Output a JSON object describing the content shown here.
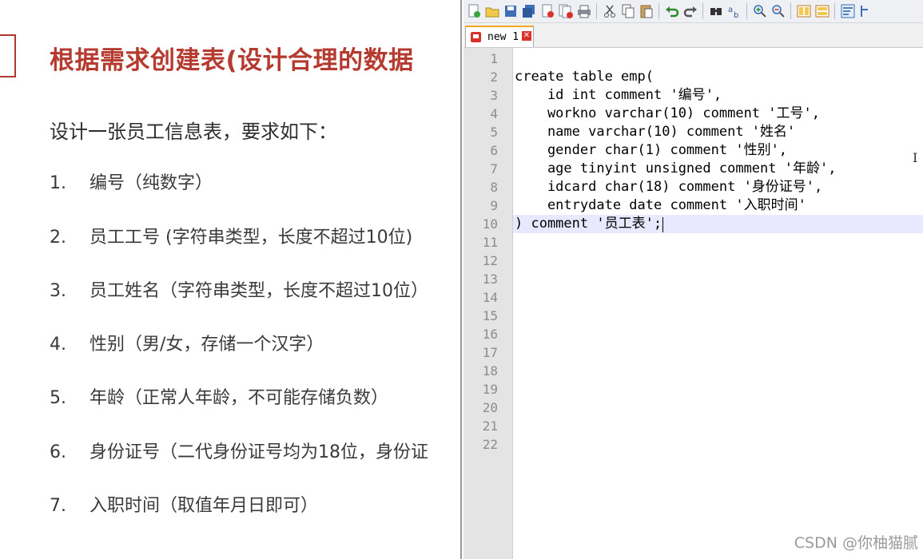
{
  "slide": {
    "title": "根据需求创建表(设计合理的数据",
    "subtitle": "设计一张员工信息表，要求如下：",
    "requirements": [
      {
        "num": "1.",
        "text": "编号（纯数字）"
      },
      {
        "num": "2.",
        "text": "员工工号 (字符串类型，长度不超过10位)"
      },
      {
        "num": "3.",
        "text": "员工姓名（字符串类型，长度不超过10位）"
      },
      {
        "num": "4.",
        "text": "性别（男/女，存储一个汉字）"
      },
      {
        "num": "5.",
        "text": "年龄（正常人年龄，不可能存储负数）"
      },
      {
        "num": "6.",
        "text": "身份证号（二代身份证号均为18位，身份证"
      },
      {
        "num": "7.",
        "text": "入职时间（取值年月日即可）"
      }
    ]
  },
  "editor": {
    "tab_label": "new 1",
    "tab_close": "✕",
    "line_numbers": [
      "1",
      "2",
      "3",
      "4",
      "5",
      "6",
      "7",
      "8",
      "9",
      "10",
      "11",
      "12",
      "13",
      "14",
      "15",
      "16",
      "17",
      "18",
      "19",
      "20",
      "21",
      "22"
    ],
    "code_lines": [
      "",
      "create table emp(",
      "    id int comment '编号',",
      "    workno varchar(10) comment '工号',",
      "    name varchar(10) comment '姓名'",
      "    gender char(1) comment '性别',",
      "    age tinyint unsigned comment '年龄',",
      "    idcard char(18) comment '身份证号',",
      "    entrydate date comment '入职时间'",
      ") comment '员工表';"
    ],
    "toolbar_icons": [
      "new-file-icon",
      "open-file-icon",
      "save-icon",
      "save-all-icon",
      "close-icon",
      "close-all-icon",
      "print-icon",
      "cut-icon",
      "copy-icon",
      "paste-icon",
      "undo-icon",
      "redo-icon",
      "find-icon",
      "replace-icon",
      "zoom-in-icon",
      "zoom-out-icon",
      "sync-vertical-icon",
      "sync-horizontal-icon",
      "word-wrap-icon",
      "indent-guide-icon"
    ]
  },
  "cursor_glyph": "I",
  "watermark": "CSDN @你柚猫腻",
  "colors": {
    "title_red": "#b53a2f",
    "tab_accent": "#f5a623",
    "current_line": "#e8e8ff",
    "gutter": "#e4e4e4"
  }
}
